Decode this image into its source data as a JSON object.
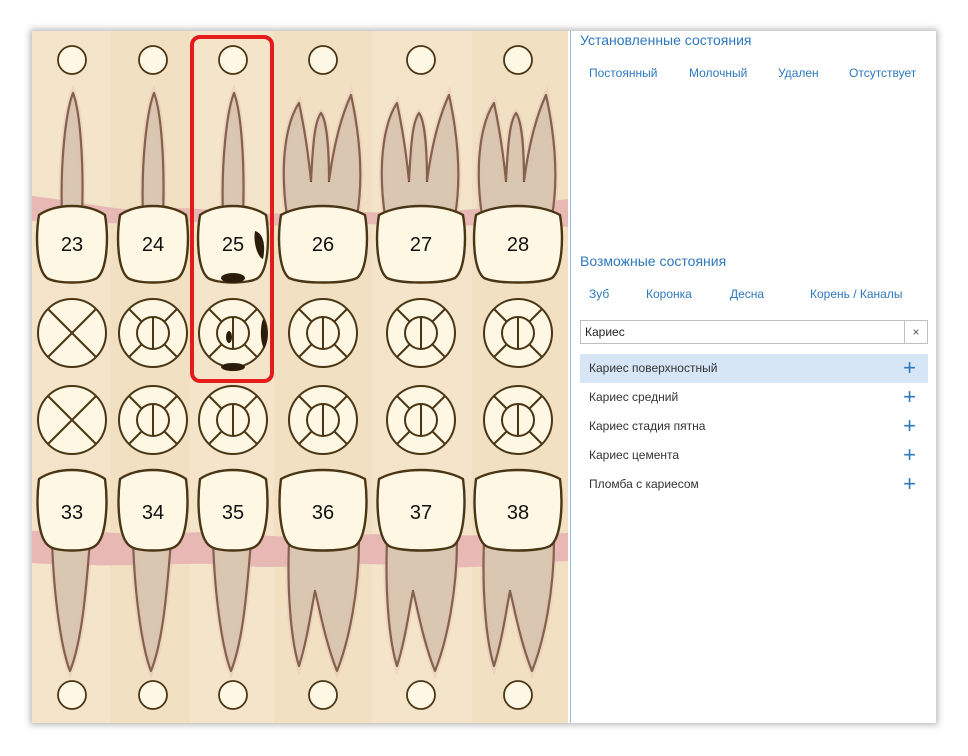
{
  "installed": {
    "title": "Установленные состояния",
    "tabs": [
      "Постоянный",
      "Молочный",
      "Удален",
      "Отсутствует"
    ]
  },
  "possible": {
    "title": "Возможные состояния",
    "tabs": [
      "Зуб",
      "Коронка",
      "Десна",
      "Корень / Каналы"
    ],
    "search_value": "Кариес",
    "clear_icon": "×",
    "items": [
      {
        "label": "Кариес поверхностный",
        "active": true
      },
      {
        "label": "Кариес средний",
        "active": false
      },
      {
        "label": "Кариес стадия пятна",
        "active": false
      },
      {
        "label": "Кариес цемента",
        "active": false
      },
      {
        "label": "Пломба с кариесом",
        "active": false
      }
    ],
    "add_icon": "+"
  },
  "teeth": {
    "upper": [
      "23",
      "24",
      "25",
      "26",
      "27",
      "28"
    ],
    "lower": [
      "33",
      "34",
      "35",
      "36",
      "37",
      "38"
    ],
    "selected": "25"
  },
  "colors": {
    "accent": "#2e78bd",
    "highlight": "#e41b1b",
    "gum": "#e8b8b5",
    "crown": "#fdf7e3",
    "root": "#d9c7b1",
    "outline": "#4a3614",
    "background": "#f3e3c6"
  }
}
